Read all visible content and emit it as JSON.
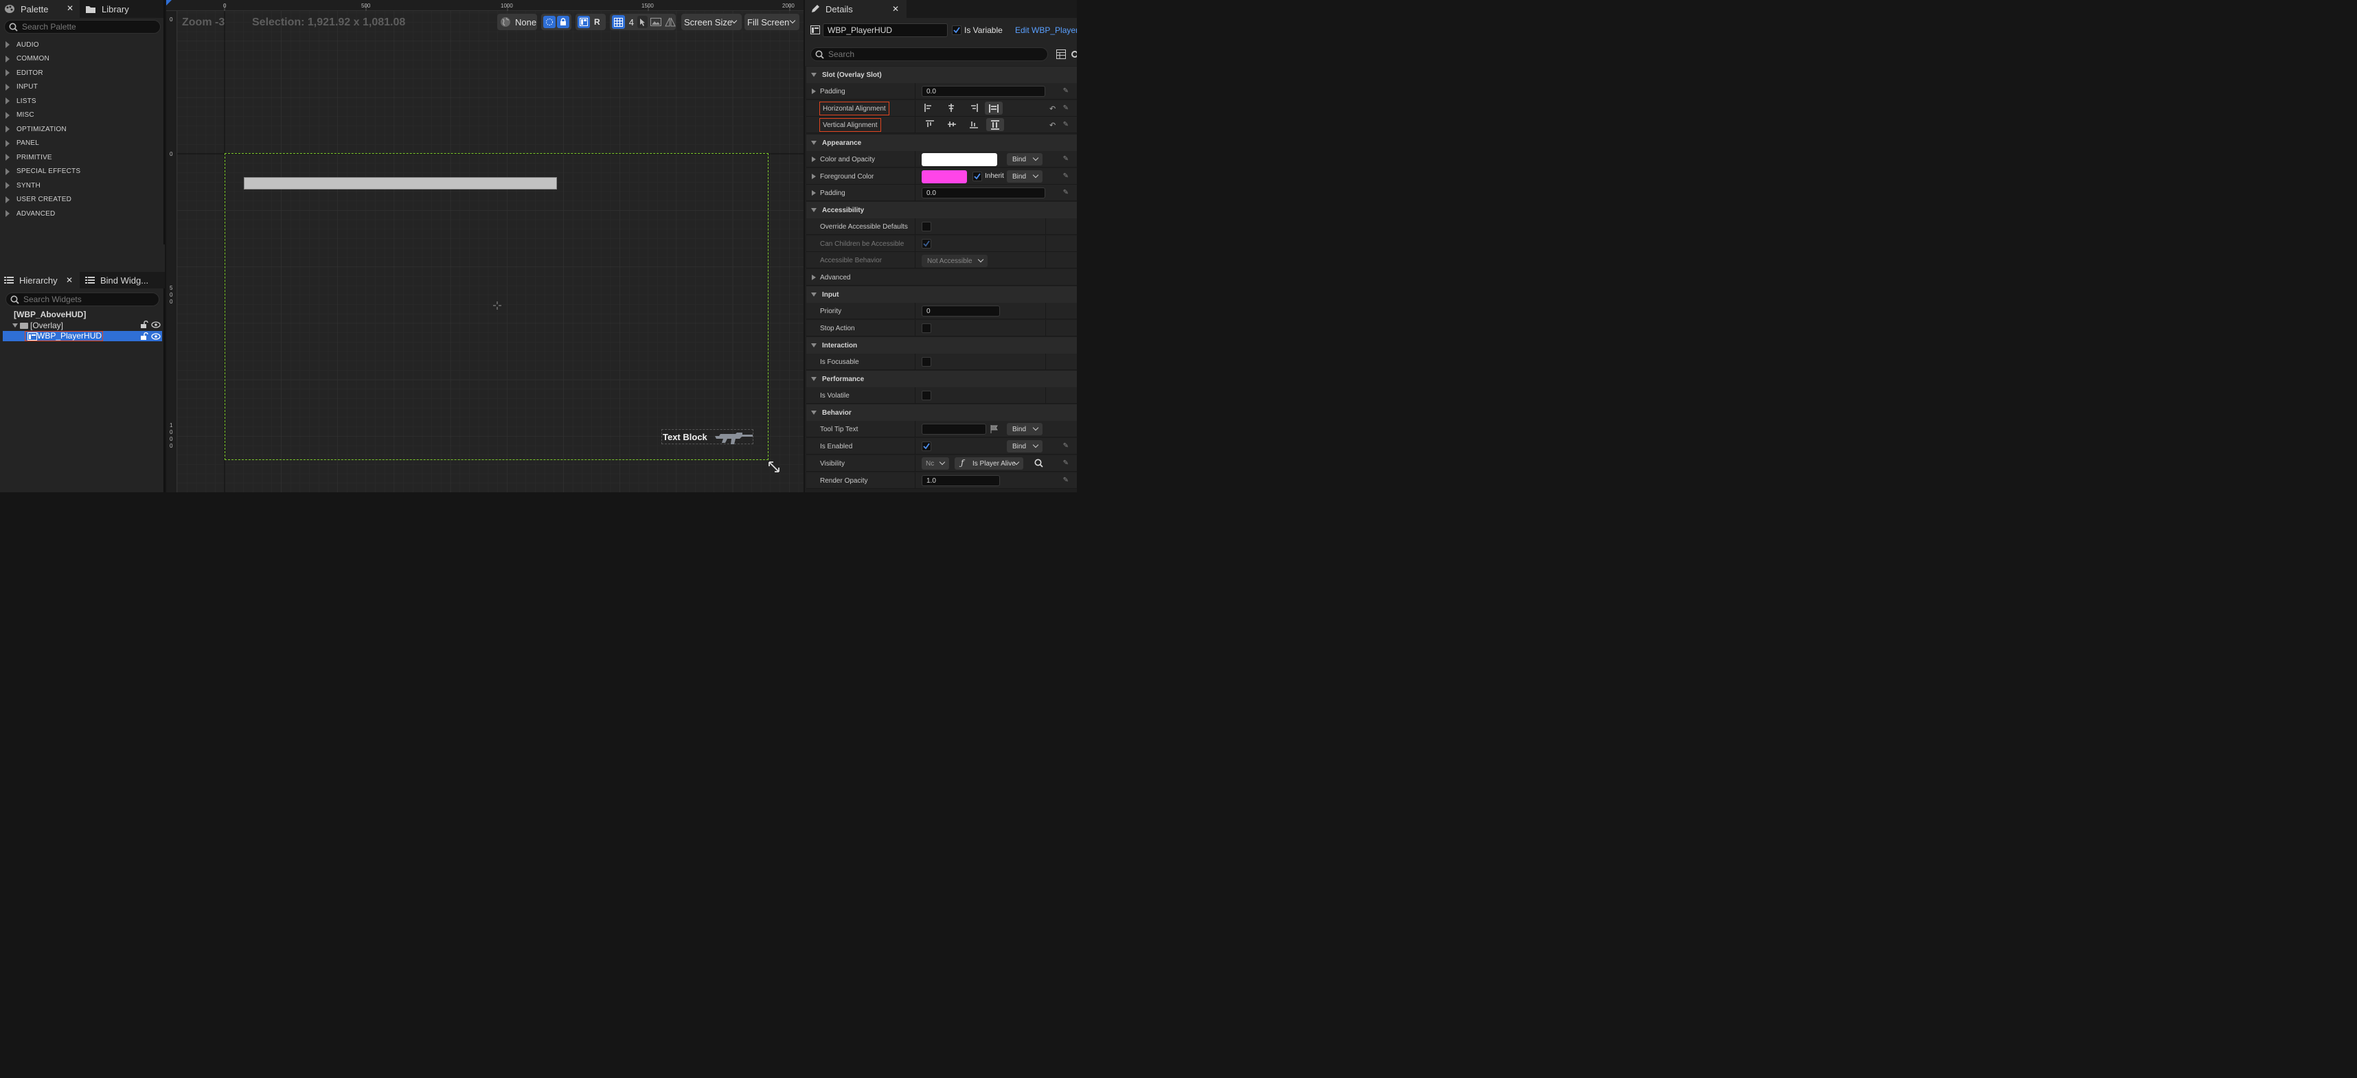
{
  "palette": {
    "tab_label": "Palette",
    "library_tab_label": "Library",
    "search_placeholder": "Search Palette",
    "categories": [
      "AUDIO",
      "COMMON",
      "EDITOR",
      "INPUT",
      "LISTS",
      "MISC",
      "OPTIMIZATION",
      "PANEL",
      "PRIMITIVE",
      "SPECIAL EFFECTS",
      "SYNTH",
      "USER CREATED",
      "ADVANCED"
    ]
  },
  "hierarchy": {
    "tab_label": "Hierarchy",
    "bind_tab_label": "Bind Widg...",
    "search_placeholder": "Search Widgets",
    "root": "[WBP_AboveHUD]",
    "overlay": "[Overlay]",
    "selected": "WBP_PlayerHUD"
  },
  "viewport": {
    "zoom": "Zoom -3",
    "selection": "Selection: 1,921.92 x 1,081.08",
    "toolbar": {
      "none_label": "None",
      "r_label": "R",
      "grid_count": "4",
      "screen_size": "Screen Size",
      "fill_screen": "Fill Screen"
    },
    "ruler_top": [
      "0",
      "500",
      "1000",
      "1500",
      "2000"
    ],
    "ruler_left": [
      "0",
      "0",
      "5\n0\n0",
      "1\n0\n0\n0"
    ],
    "ruler_left_first": "0",
    "text_block": "Text Block"
  },
  "details": {
    "tab_label": "Details",
    "widget_name": "WBP_PlayerHUD",
    "is_variable_label": "Is Variable",
    "edit_link": "Edit WBP_PlayerHUD",
    "search_placeholder": "Search",
    "sections": {
      "slot": "Slot (Overlay Slot)",
      "appearance": "Appearance",
      "accessibility": "Accessibility",
      "input": "Input",
      "interaction": "Interaction",
      "performance": "Performance",
      "behavior": "Behavior"
    },
    "props": {
      "padding": "Padding",
      "padding_value": "0.0",
      "h_align": "Horizontal Alignment",
      "v_align": "Vertical Alignment",
      "color_opacity": "Color and Opacity",
      "foreground_color": "Foreground Color",
      "inherit": "Inherit",
      "padding2": "Padding",
      "padding2_value": "0.0",
      "override_accessible": "Override Accessible Defaults",
      "can_children": "Can Children be Accessible",
      "accessible_behavior": "Accessible Behavior",
      "accessible_behavior_value": "Not Accessible",
      "advanced": "Advanced",
      "priority": "Priority",
      "priority_value": "0",
      "stop_action": "Stop Action",
      "is_focusable": "Is Focusable",
      "is_volatile": "Is Volatile",
      "tooltip": "Tool Tip Text",
      "is_enabled": "Is Enabled",
      "visibility": "Visibility",
      "visibility_value": "Nc",
      "visibility_binding": "Is Player Alive",
      "render_opacity": "Render Opacity",
      "render_opacity_value": "1.0",
      "bind": "Bind"
    }
  },
  "colors": {
    "accent": "#2f6fd6",
    "selection_green": "#7ecb2c",
    "highlight_red": "#e0441f",
    "foreground_magenta": "#ff45e8"
  }
}
